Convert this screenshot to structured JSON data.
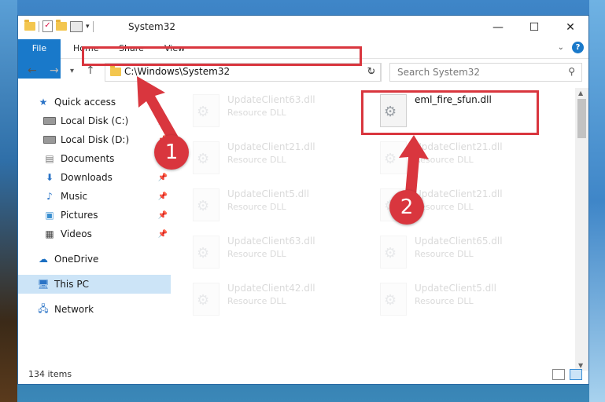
{
  "window": {
    "title": "System32",
    "controls": {
      "minimize": "—",
      "maximize": "☐",
      "close": "✕"
    }
  },
  "ribbon": {
    "tabs": [
      "File",
      "Home",
      "Share",
      "View"
    ],
    "help": "?"
  },
  "navigation": {
    "address": "C:\\Windows\\System32",
    "search_placeholder": "Search System32"
  },
  "sidebar": {
    "items": [
      {
        "label": "Quick access",
        "icon": "star-icon",
        "pinned": false
      },
      {
        "label": "Local Disk (C:)",
        "icon": "drive-icon",
        "pinned": true
      },
      {
        "label": "Local Disk (D:)",
        "icon": "drive-icon",
        "pinned": true
      },
      {
        "label": "Documents",
        "icon": "documents-icon",
        "pinned": true
      },
      {
        "label": "Downloads",
        "icon": "downloads-icon",
        "pinned": true
      },
      {
        "label": "Music",
        "icon": "music-icon",
        "pinned": true
      },
      {
        "label": "Pictures",
        "icon": "pictures-icon",
        "pinned": true
      },
      {
        "label": "Videos",
        "icon": "videos-icon",
        "pinned": true
      },
      {
        "label": "OneDrive",
        "icon": "cloud-icon",
        "pinned": false
      },
      {
        "label": "This PC",
        "icon": "computer-icon",
        "pinned": false,
        "selected": true
      },
      {
        "label": "Network",
        "icon": "network-icon",
        "pinned": false
      }
    ]
  },
  "files": [
    {
      "name": "UpdateClient63.dll",
      "type": "Resource DLL",
      "faded": true
    },
    {
      "name": "eml_fire_sfun.dll",
      "type": "",
      "faded": false
    },
    {
      "name": "UpdateClient21.dll",
      "type": "Resource DLL",
      "faded": true
    },
    {
      "name": "UpdateClient21.dll",
      "type": "Resource DLL",
      "faded": true
    },
    {
      "name": "UpdateClient5.dll",
      "type": "Resource DLL",
      "faded": true
    },
    {
      "name": "UpdateClient21.dll",
      "type": "Resource DLL",
      "faded": true
    },
    {
      "name": "UpdateClient63.dll",
      "type": "Resource DLL",
      "faded": true
    },
    {
      "name": "UpdateClient65.dll",
      "type": "Resource DLL",
      "faded": true
    },
    {
      "name": "UpdateClient42.dll",
      "type": "Resource DLL",
      "faded": true
    },
    {
      "name": "UpdateClient5.dll",
      "type": "Resource DLL",
      "faded": true
    }
  ],
  "status": {
    "item_count": "134 items"
  },
  "annotations": {
    "badge_1": "1",
    "badge_2": "2",
    "highlight_color": "#d9363e"
  },
  "colors": {
    "accent": "#1979ca",
    "selection": "#cce4f7"
  }
}
